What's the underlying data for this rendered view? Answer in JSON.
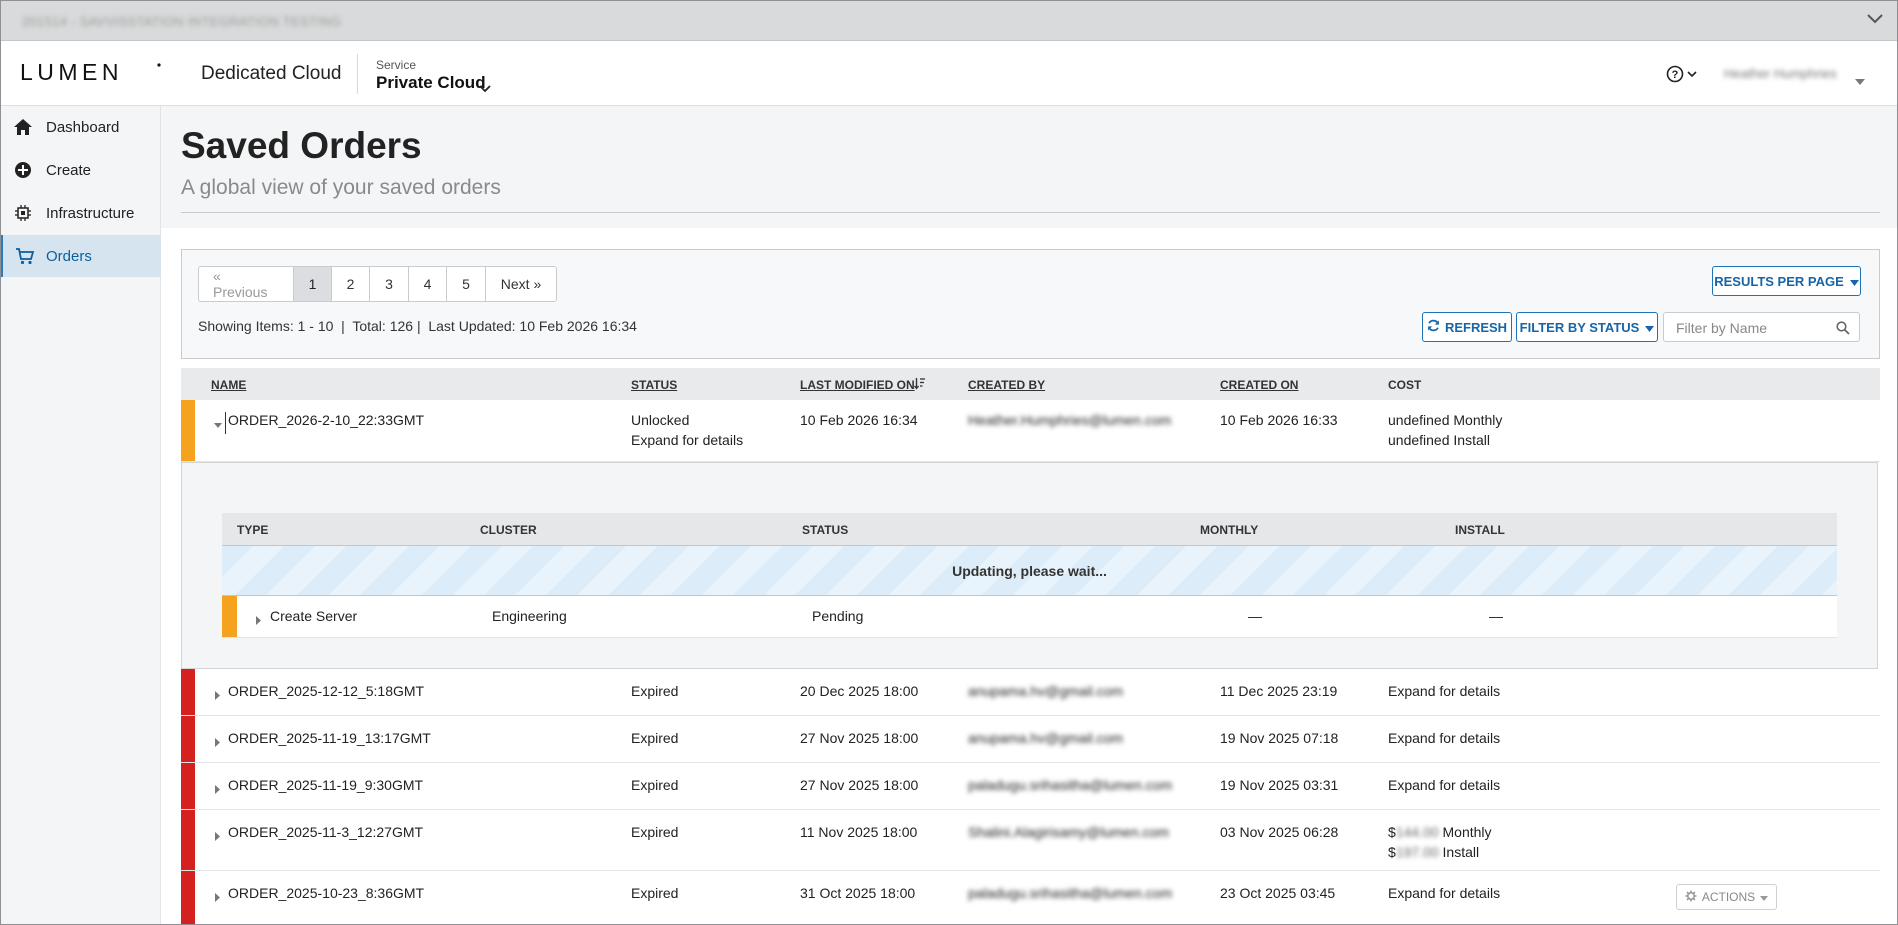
{
  "banner": {
    "text": "201514 - SAVVISSTATION INTEGRATION TESTING"
  },
  "header": {
    "logo": "LUMEN",
    "app_title": "Dedicated Cloud",
    "service_label": "Service",
    "service_value": "Private Cloud",
    "user_name": "Heather Humphries"
  },
  "sidebar": {
    "items": [
      {
        "label": "Dashboard",
        "icon": "home-icon"
      },
      {
        "label": "Create",
        "icon": "plus-circle-icon"
      },
      {
        "label": "Infrastructure",
        "icon": "chip-icon"
      },
      {
        "label": "Orders",
        "icon": "cart-icon",
        "active": true
      }
    ]
  },
  "page": {
    "title": "Saved Orders",
    "subtitle": "A global view of your saved orders"
  },
  "toolbar": {
    "pager": [
      "« Previous",
      "1",
      "2",
      "3",
      "4",
      "5",
      "Next »"
    ],
    "current_page": "1",
    "showing": "Showing Items: 1 - 10  |  Total: 126 |  Last Updated: 10 Feb 2026 16:34",
    "results_per_page": "RESULTS PER PAGE",
    "refresh": "REFRESH",
    "filter_status": "FILTER BY STATUS",
    "search_placeholder": "Filter by Name"
  },
  "table": {
    "headers": {
      "name": "NAME",
      "status": "STATUS",
      "last_modified": "LAST MODIFIED ON",
      "created_by": "CREATED BY",
      "created_on": "CREATED ON",
      "cost": "COST"
    },
    "rows": [
      {
        "name": "ORDER_2026-2-10_22:33GMT",
        "status": "Unlocked",
        "status2": "Expand for details",
        "last_modified": "10 Feb 2026 16:34",
        "created_by": "Heather.Humphries@lumen.com",
        "created_on": "10 Feb 2026 16:33",
        "cost": "undefined Monthly",
        "cost2": "undefined Install",
        "color": "#f5a21f"
      },
      {
        "name": "ORDER_2025-12-12_5:18GMT",
        "status": "Expired",
        "last_modified": "20 Dec 2025 18:00",
        "created_by": "anupama.hv@gmail.com",
        "created_on": "11 Dec 2025 23:19",
        "cost": "Expand for details",
        "color": "#d4201e"
      },
      {
        "name": "ORDER_2025-11-19_13:17GMT",
        "status": "Expired",
        "last_modified": "27 Nov 2025 18:00",
        "created_by": "anupama.hv@gmail.com",
        "created_on": "19 Nov 2025 07:18",
        "cost": "Expand for details",
        "color": "#d4201e"
      },
      {
        "name": "ORDER_2025-11-19_9:30GMT",
        "status": "Expired",
        "last_modified": "27 Nov 2025 18:00",
        "created_by": "paladugu.srihasitha@lumen.com",
        "created_on": "19 Nov 2025 03:31",
        "cost": "Expand for details",
        "color": "#d4201e"
      },
      {
        "name": "ORDER_2025-11-3_12:27GMT",
        "status": "Expired",
        "last_modified": "11 Nov 2025 18:00",
        "created_by": "Shalini.Alagirisamy@lumen.com",
        "created_on": "03 Nov 2025 06:28",
        "cost_prefix": "$",
        "cost_amount": "144.00",
        "cost": "Monthly",
        "cost2_amount": "197.00",
        "cost2": "Install",
        "color": "#d4201e"
      },
      {
        "name": "ORDER_2025-10-23_8:36GMT",
        "status": "Expired",
        "last_modified": "31 Oct 2025 18:00",
        "created_by": "paladugu.srihasitha@lumen.com",
        "created_on": "23 Oct 2025 03:45",
        "cost": "Expand for details",
        "color": "#d4201e"
      }
    ],
    "actions": "ACTIONS"
  },
  "detail": {
    "headers": {
      "type": "TYPE",
      "cluster": "CLUSTER",
      "status": "STATUS",
      "monthly": "MONTHLY",
      "install": "INSTALL"
    },
    "updating": "Updating, please wait...",
    "row": {
      "type": "Create Server",
      "cluster": "Engineering",
      "status": "Pending",
      "monthly": "—",
      "install": "—"
    }
  },
  "colors": {
    "accent": "#1565a8",
    "unlocked": "#f5a21f",
    "expired": "#d4201e",
    "active_nav": "#d6e4f0"
  }
}
